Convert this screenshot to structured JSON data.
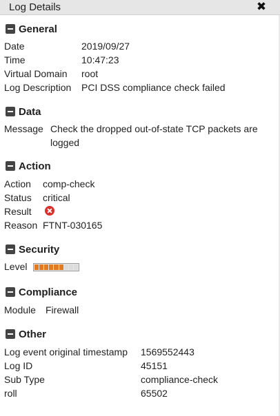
{
  "window": {
    "title": "Log Details",
    "close_icon": "close-icon"
  },
  "colors": {
    "level_fill": "#e07b24",
    "level_empty": "#dcdcdc",
    "error": "#d9302c",
    "header_bg": "#e6e6e6"
  },
  "sections": {
    "general": {
      "title": "General",
      "rows": [
        {
          "label": "Date",
          "value": "2019/09/27"
        },
        {
          "label": "Time",
          "value": "10:47:23"
        },
        {
          "label": "Virtual Domain",
          "value": "root"
        },
        {
          "label": "Log Description",
          "value": "PCI DSS compliance check failed"
        }
      ]
    },
    "data": {
      "title": "Data",
      "rows": [
        {
          "label": "Message",
          "value": "Check the dropped out-of-state TCP packets are logged"
        }
      ]
    },
    "action": {
      "title": "Action",
      "rows": [
        {
          "label": "Action",
          "value": "comp-check"
        },
        {
          "label": "Status",
          "value": "critical"
        },
        {
          "label": "Result",
          "icon": "error-x-icon"
        },
        {
          "label": "Reason",
          "value": "FTNT-030165"
        }
      ]
    },
    "security": {
      "title": "Security",
      "level_label": "Level",
      "level": {
        "filled": 6,
        "total": 9
      }
    },
    "compliance": {
      "title": "Compliance",
      "rows": [
        {
          "label": "Module",
          "value": "Firewall"
        }
      ]
    },
    "other": {
      "title": "Other",
      "rows": [
        {
          "label": "Log event original timestamp",
          "value": "1569552443"
        },
        {
          "label": "Log ID",
          "value": "45151"
        },
        {
          "label": "Sub Type",
          "value": "compliance-check"
        },
        {
          "label": "roll",
          "value": "65502"
        }
      ]
    }
  }
}
